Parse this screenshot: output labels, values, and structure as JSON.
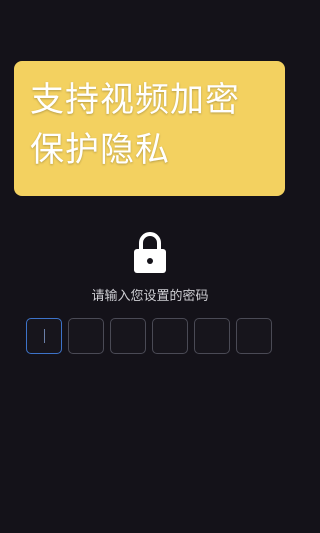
{
  "banner": {
    "line1": "支持视频加密",
    "line2": "保护隐私"
  },
  "lock": {
    "icon": "lock-icon"
  },
  "passcode": {
    "prompt": "请输入您设置的密码",
    "digits": [
      "",
      "",
      "",
      "",
      "",
      ""
    ],
    "active_index": 0
  },
  "colors": {
    "background": "#141219",
    "banner": "#f3d160",
    "active_border": "#3d73c9"
  }
}
